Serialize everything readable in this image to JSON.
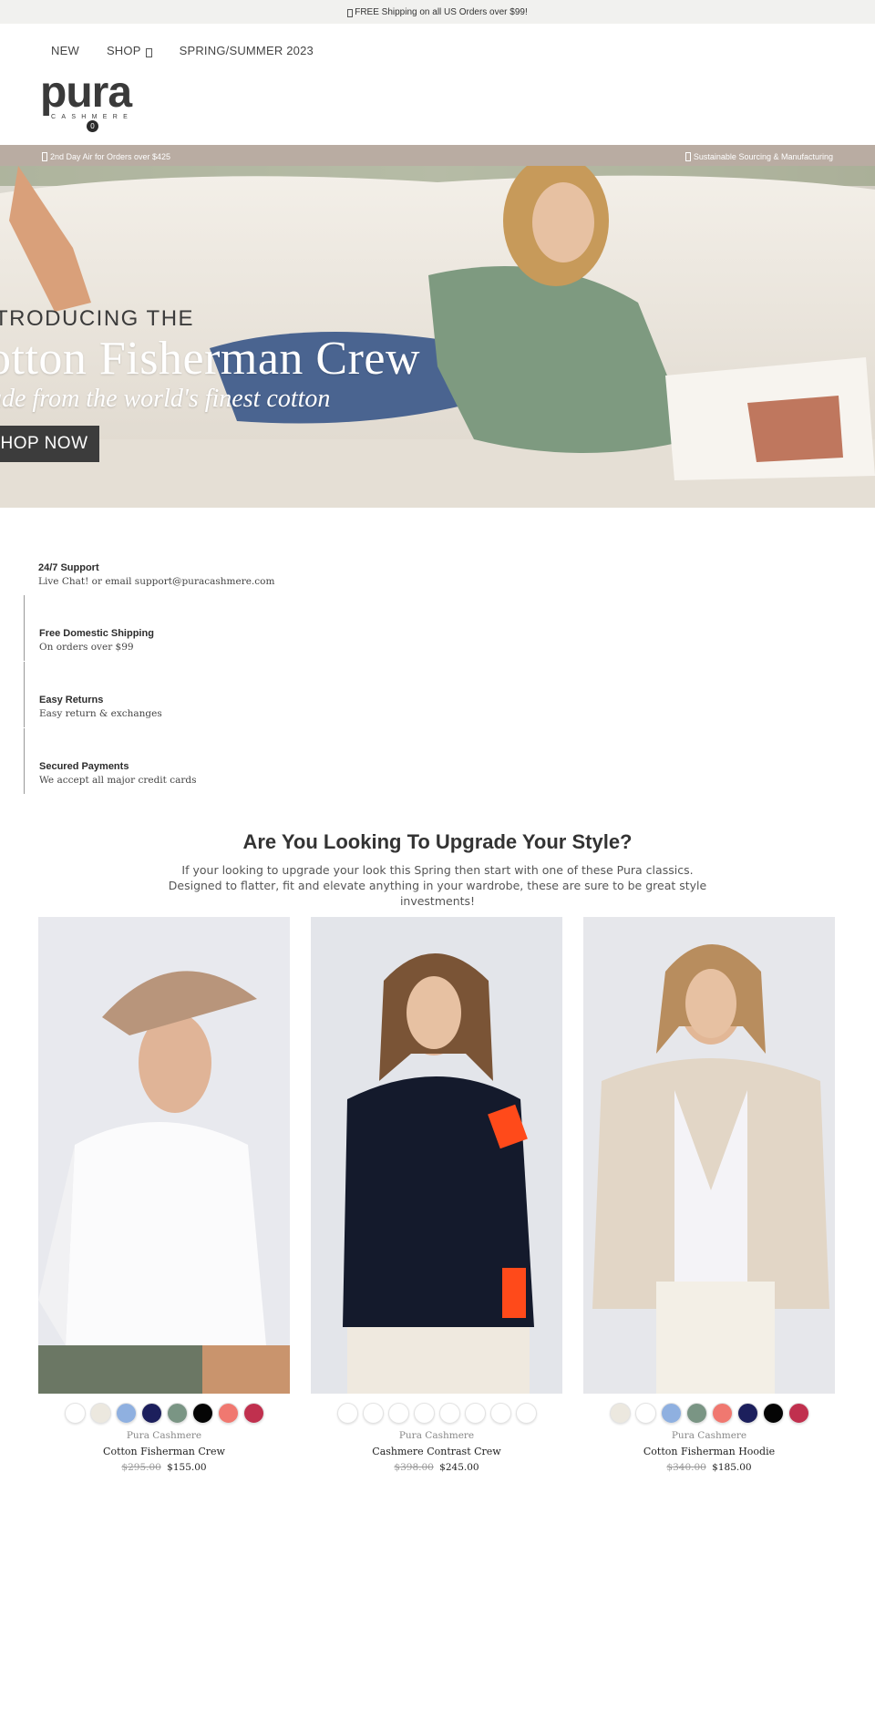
{
  "announcement": {
    "text": "FREE Shipping on all US Orders over $99!",
    "icon": "truck-icon"
  },
  "nav": {
    "items": [
      {
        "label": "NEW"
      },
      {
        "label": "SHOP"
      },
      {
        "label": "SPRING/SUMMER 2023"
      }
    ]
  },
  "logo": {
    "wordmark": "pura",
    "tagline": "CASHMERE"
  },
  "cart": {
    "count": "0"
  },
  "promo_bar": {
    "left": "2nd Day Air for Orders over $425",
    "right": "Sustainable Sourcing & Manufacturing"
  },
  "hero": {
    "line1": "TRODUCING THE",
    "line2": "otton Fisherman Crew",
    "line3": "ade from the world's finest cotton",
    "cta": "HOP NOW"
  },
  "features": [
    {
      "title": "24/7 Support",
      "desc": "Live Chat! or email support@puracashmere.com"
    },
    {
      "title": "Free Domestic Shipping",
      "desc": "On orders over $99"
    },
    {
      "title": "Easy Returns",
      "desc": "Easy return & exchanges"
    },
    {
      "title": "Secured Payments",
      "desc": "We accept all major credit cards"
    }
  ],
  "section": {
    "title": "Are You Looking To Upgrade Your Style?",
    "subtitle": "If your looking to upgrade your look this Spring then start with one of these Pura classics. Designed to flatter, fit and elevate anything in your wardrobe, these are sure to be great style investments!"
  },
  "products": [
    {
      "brand": "Pura Cashmere",
      "name": "Cotton Fisherman Crew",
      "old_price": "$295.00",
      "price": "$155.00",
      "swatches": [
        "#ffffff",
        "#ece8df",
        "#8fb0e0",
        "#1c1f5c",
        "#7a9584",
        "#050505",
        "#f07870",
        "#c0304e"
      ]
    },
    {
      "brand": "Pura Cashmere",
      "name": "Cashmere Contrast Crew",
      "old_price": "$398.00",
      "price": "$245.00",
      "swatches": [
        "#ffffff",
        "#ffffff",
        "#ffffff",
        "#ffffff",
        "#ffffff",
        "#ffffff",
        "#ffffff",
        "#ffffff"
      ]
    },
    {
      "brand": "Pura Cashmere",
      "name": "Cotton Fisherman Hoodie",
      "old_price": "$340.00",
      "price": "$185.00",
      "swatches": [
        "#ece8df",
        "#ffffff",
        "#8fb0e0",
        "#7a9584",
        "#f07870",
        "#1c1f5c",
        "#050505",
        "#c0304e"
      ]
    }
  ]
}
